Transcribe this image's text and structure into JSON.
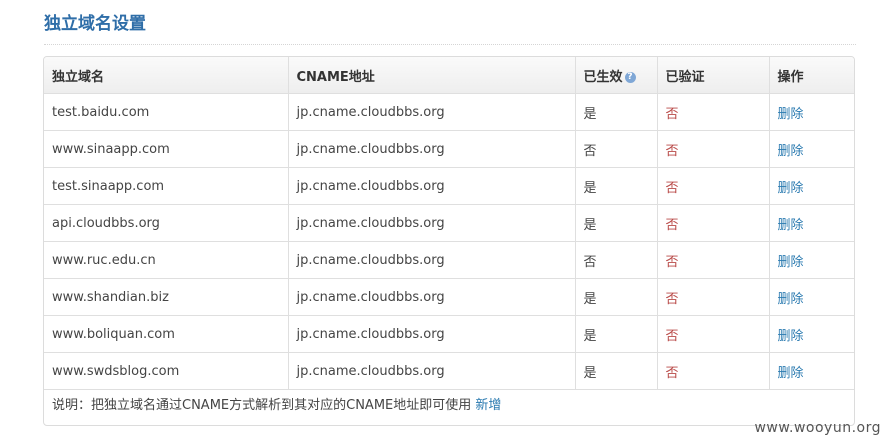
{
  "page": {
    "title": "独立域名设置"
  },
  "table": {
    "headers": {
      "domain": "独立域名",
      "cname": "CNAME地址",
      "active": "已生效",
      "verified": "已验证",
      "action": "操作"
    },
    "rows": [
      {
        "domain": "test.baidu.com",
        "cname": "jp.cname.cloudbbs.org",
        "active": "是",
        "verified": "否",
        "action": "删除"
      },
      {
        "domain": "www.sinaapp.com",
        "cname": "jp.cname.cloudbbs.org",
        "active": "否",
        "verified": "否",
        "action": "删除"
      },
      {
        "domain": "test.sinaapp.com",
        "cname": "jp.cname.cloudbbs.org",
        "active": "是",
        "verified": "否",
        "action": "删除"
      },
      {
        "domain": "api.cloudbbs.org",
        "cname": "jp.cname.cloudbbs.org",
        "active": "是",
        "verified": "否",
        "action": "删除"
      },
      {
        "domain": "www.ruc.edu.cn",
        "cname": "jp.cname.cloudbbs.org",
        "active": "否",
        "verified": "否",
        "action": "删除"
      },
      {
        "domain": "www.shandian.biz",
        "cname": "jp.cname.cloudbbs.org",
        "active": "是",
        "verified": "否",
        "action": "删除"
      },
      {
        "domain": "www.boliquan.com",
        "cname": "jp.cname.cloudbbs.org",
        "active": "是",
        "verified": "否",
        "action": "删除"
      },
      {
        "domain": "www.swdsblog.com",
        "cname": "jp.cname.cloudbbs.org",
        "active": "是",
        "verified": "否",
        "action": "删除"
      }
    ]
  },
  "footer": {
    "note": "说明：把独立域名通过CNAME方式解析到其对应的CNAME地址即可使用",
    "add_link": "新增"
  },
  "watermark": "www.wooyun.org",
  "colors": {
    "title": "#2f6ea8",
    "link": "#2a7ab0",
    "no": "#b94a48",
    "help_icon": "#7fa7d6"
  },
  "icons": {
    "active_help": "question-circle-icon"
  }
}
